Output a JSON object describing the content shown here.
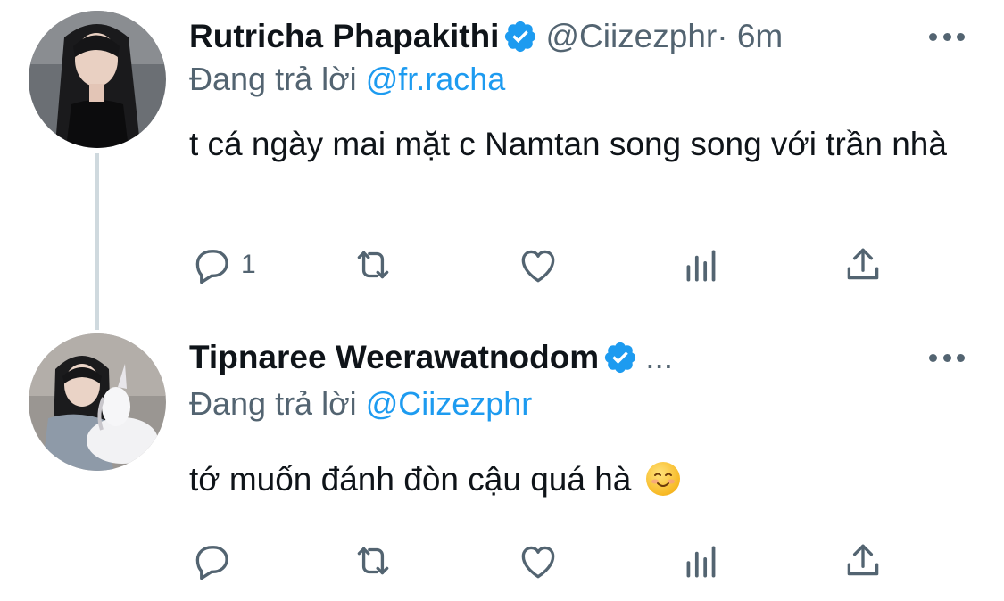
{
  "tweets": [
    {
      "name": "Rutricha Phapakithi",
      "handle": "@Ciizezphr",
      "time_sep": " · 6m",
      "reply_prefix": "Đang trả lời ",
      "reply_to": "@fr.racha",
      "text": "t cá ngày mai mặt c Namtan song song với trần nhà",
      "reply_count": "1",
      "avatar_icon": "avatar-woman-long-hair",
      "verified_color": "#1d9bf0"
    },
    {
      "name": "Tipnaree Weerawatnodom",
      "handle_truncated": "...",
      "reply_prefix": "Đang trả lời ",
      "reply_to": "@Ciizezphr",
      "text": "tớ muốn đánh đòn cậu quá hà",
      "emoji": "smiling-face-emoji",
      "reply_count": "",
      "avatar_icon": "avatar-woman-with-unicorn-plush",
      "verified_color": "#1d9bf0"
    }
  ],
  "colors": {
    "accent": "#1d9bf0",
    "secondary_text": "#536471",
    "primary_text": "#0f1419",
    "thread_line": "#cfd9de"
  }
}
